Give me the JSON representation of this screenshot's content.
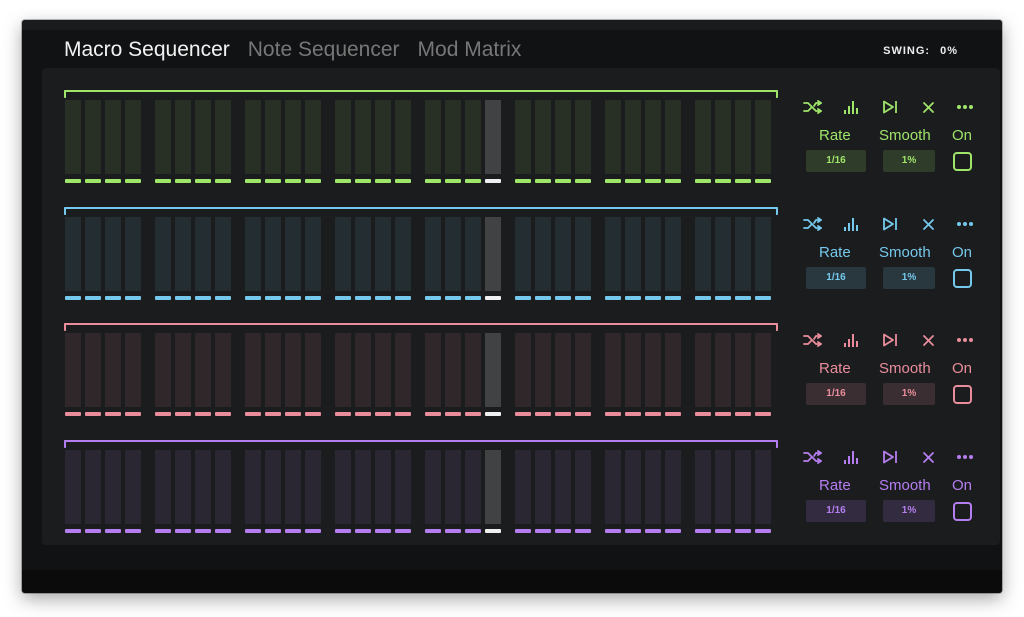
{
  "header": {
    "tabs": [
      {
        "label": "Macro Sequencer",
        "active": true
      },
      {
        "label": "Note Sequencer",
        "active": false
      },
      {
        "label": "Mod Matrix",
        "active": false
      }
    ],
    "swing_label": "SWING:",
    "swing_value": "0%"
  },
  "tracks": [
    {
      "color": "#9fe56a",
      "rate_label": "Rate",
      "rate_value": "1/16",
      "smooth_label": "Smooth",
      "smooth_value": "1%",
      "on_label": "On"
    },
    {
      "color": "#74c9ec",
      "rate_label": "Rate",
      "rate_value": "1/16",
      "smooth_label": "Smooth",
      "smooth_value": "1%",
      "on_label": "On"
    },
    {
      "color": "#e98d9c",
      "rate_label": "Rate",
      "rate_value": "1/16",
      "smooth_label": "Smooth",
      "smooth_value": "1%",
      "on_label": "On"
    },
    {
      "color": "#b57ef0",
      "rate_label": "Rate",
      "rate_value": "1/16",
      "smooth_label": "Smooth",
      "smooth_value": "1%",
      "on_label": "On"
    }
  ],
  "steps_per_track": 32,
  "active_step_index": 19,
  "icons": [
    "shuffle-icon",
    "bar-levels-icon",
    "skip-forward-icon",
    "clear-icon",
    "more-icon"
  ]
}
